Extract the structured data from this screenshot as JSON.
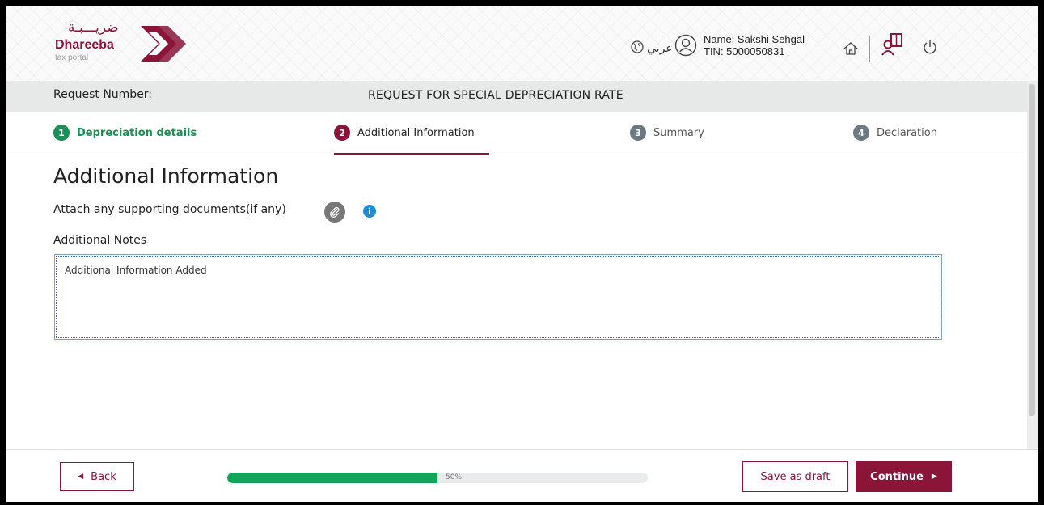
{
  "header": {
    "logo_arabic": "ضريـــبـة",
    "logo_name": "Dhareeba",
    "logo_sub": "tax portal",
    "language_label": "عربي",
    "user_name": "Name: Sakshi Sehgal",
    "user_tin": "TIN: 5000050831",
    "icons": [
      "globe-icon",
      "user-icon",
      "home-icon",
      "manual-icon",
      "power-icon"
    ]
  },
  "request_bar": {
    "label": "Request Number:",
    "title": "REQUEST FOR SPECIAL DEPRECIATION RATE"
  },
  "steps": [
    {
      "number": "1",
      "label": "Depreciation details",
      "state": "completed"
    },
    {
      "number": "2",
      "label": "Additional Information",
      "state": "active"
    },
    {
      "number": "3",
      "label": "Summary",
      "state": "pending"
    },
    {
      "number": "4",
      "label": "Declaration",
      "state": "pending"
    }
  ],
  "main": {
    "title": "Additional Information",
    "attach_label": "Attach any supporting documents(if any)",
    "notes_label": "Additional Notes",
    "notes_value": "Additional Information Added"
  },
  "footer": {
    "back_label": "Back",
    "progress_percent": 50,
    "progress_text": "50%",
    "save_draft_label": "Save as draft",
    "continue_label": "Continue"
  },
  "colors": {
    "brand": "#8a1538",
    "success": "#1b8f56",
    "progress": "#13a35a",
    "info": "#1a8cd8"
  }
}
